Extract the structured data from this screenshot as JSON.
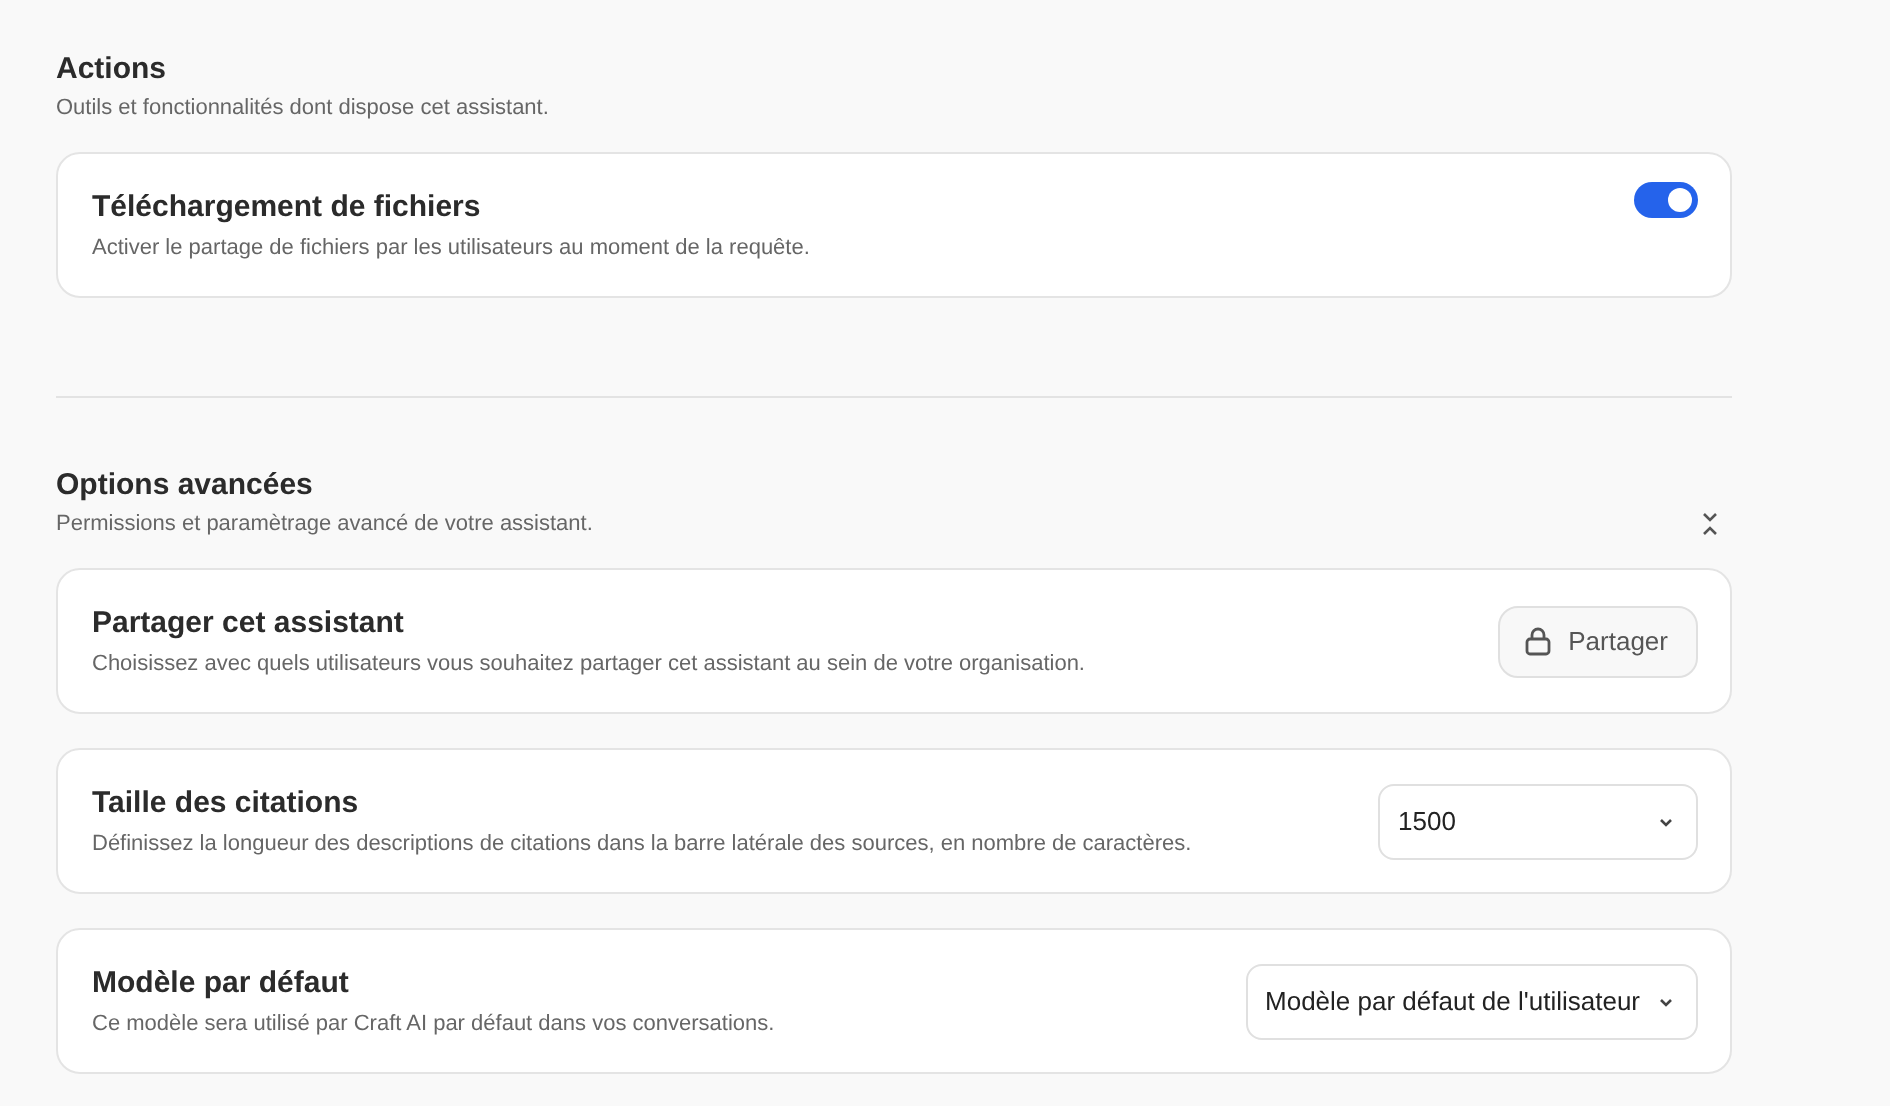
{
  "sections": [
    {
      "title": "Actions",
      "subtitle": "Outils et fonctionnalités dont dispose cet assistant.",
      "cards": [
        {
          "kind": "toggle",
          "title": "Téléchargement de fichiers",
          "description": "Activer le partage de fichiers par les utilisateurs au moment de la requête.",
          "on": true
        }
      ]
    },
    {
      "title": "Options avancées",
      "subtitle": "Permissions et paramètrage avancé de votre assistant.",
      "expanded": true,
      "cards": [
        {
          "kind": "button",
          "title": "Partager cet assistant",
          "description": "Choisissez avec quels utilisateurs vous souhaitez partager cet assistant au sein de votre organisation.",
          "button": "Partager"
        },
        {
          "kind": "select",
          "title": "Taille des citations",
          "description": "Définissez la longueur des descriptions de citations dans la barre latérale des sources, en nombre de caractères.",
          "value": "1500"
        },
        {
          "kind": "select",
          "title": "Modèle par défaut",
          "description": "Ce modèle sera utilisé par Craft AI par défaut dans vos conversations.",
          "value": "Modèle par défaut de l'utilisateur"
        }
      ]
    }
  ]
}
